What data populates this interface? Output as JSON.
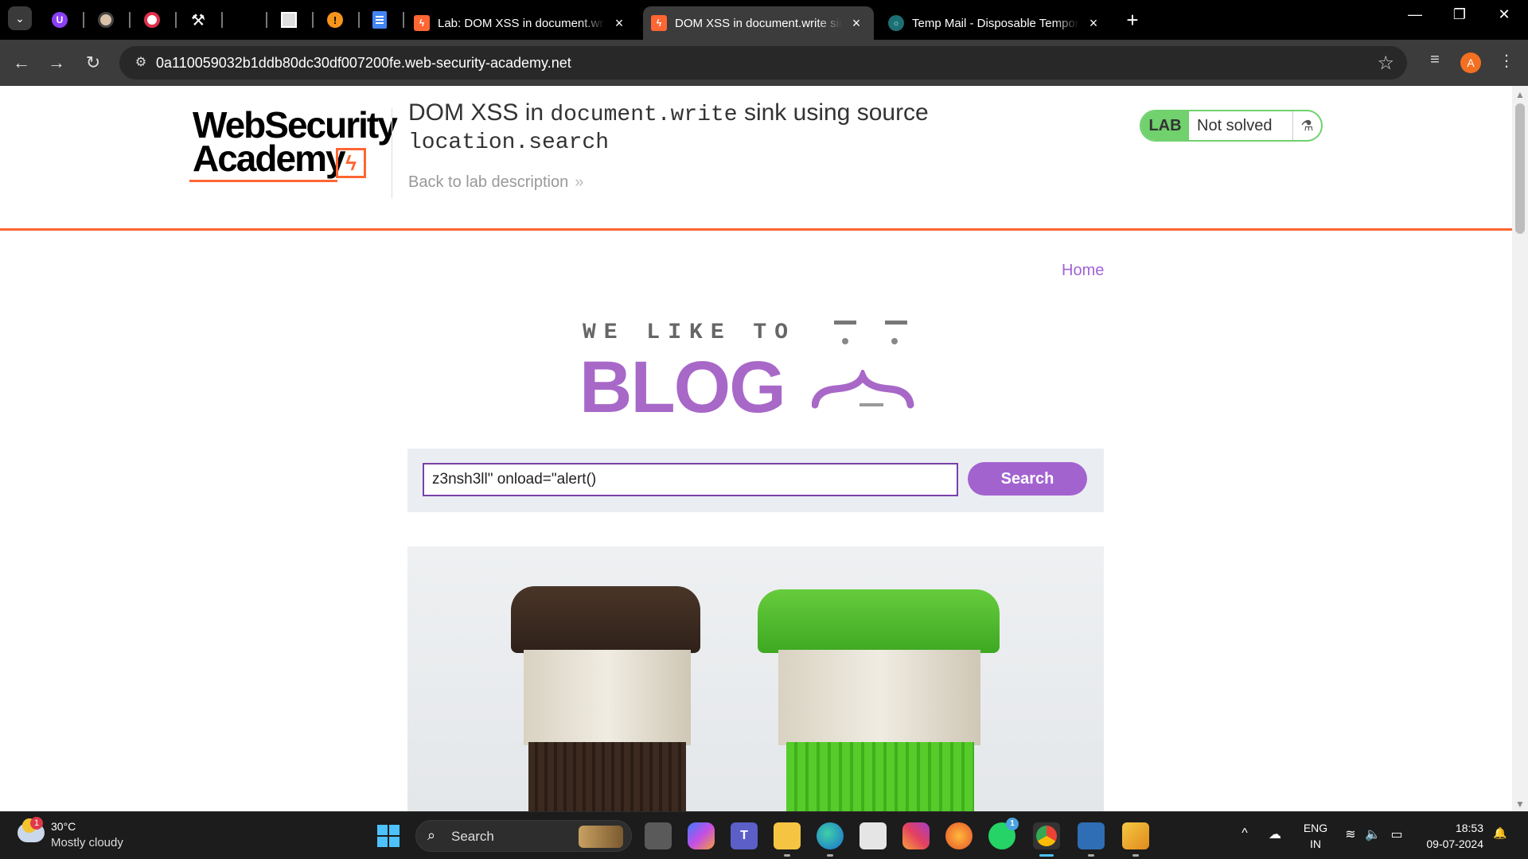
{
  "browser": {
    "tabs": [
      {
        "title": "Lab: DOM XSS in document.write",
        "favicon": "portswigger-icon",
        "active": false
      },
      {
        "title": "DOM XSS in document.write sink",
        "favicon": "portswigger-icon",
        "active": true
      },
      {
        "title": "Temp Mail - Disposable Temporary",
        "favicon": "tempmail-icon",
        "active": false
      }
    ],
    "pinned_icons": [
      "purple-shield-icon",
      "ninja-icon",
      "red-circle-icon",
      "tool-icon",
      "box-icon",
      "orange-info-icon",
      "google-docs-icon"
    ],
    "pinned_glyphs": {
      "purple": "U",
      "orange": "!"
    },
    "url": "0a110059032b1ddb80dc30df007200fe.web-security-academy.net",
    "profile_initial": "A",
    "icons": {
      "tab_close": "×",
      "new_tab": "+",
      "back": "←",
      "forward": "→",
      "reload": "↻",
      "star": "☆",
      "minimize": "—",
      "restore": "❐",
      "close": "✕",
      "menu": "⋮",
      "media": "≡",
      "site_info": "⚙",
      "tab_search": "⌄"
    }
  },
  "lab_header": {
    "logo_line1": "WebSecurity",
    "logo_line2": "Academy",
    "logo_bolt": "ϟ",
    "title_prefix": "DOM XSS in ",
    "title_code1": "document.write",
    "title_middle": " sink using source",
    "title_code2": "location.search",
    "back_link": "Back to lab description",
    "back_chevron": "»",
    "status_badge": "LAB",
    "status_text": "Not solved",
    "flask_icon": "⚗"
  },
  "blog": {
    "nav_home": "Home",
    "logo_top": "WE LIKE TO",
    "logo_big": "BLOG",
    "search_value": "z3nsh3ll\" onload=\"alert()",
    "search_button": "Search"
  },
  "scrollbar": {
    "up": "▲",
    "down": "▼"
  },
  "taskbar": {
    "weather_temp": "30°C",
    "weather_desc": "Mostly cloudy",
    "weather_badge": "1",
    "search_label": "Search",
    "search_icon": "⌕",
    "apps": [
      "task-view-icon",
      "copilot-icon",
      "teams-icon",
      "file-explorer-icon",
      "edge-icon",
      "ms-store-icon",
      "instagram-icon",
      "firefox-icon",
      "whatsapp-icon",
      "chrome-icon",
      "virtualbox-icon",
      "burp-icon"
    ],
    "whatsapp_badge": "1",
    "lang_line1": "ENG",
    "lang_line2": "IN",
    "time": "18:53",
    "date": "09-07-2024",
    "tray_up": "^",
    "tray_cloud": "☁",
    "tray_wifi": "≋",
    "tray_volume": "🔈",
    "tray_battery": "▭",
    "tray_bell": "🔔"
  },
  "colors": {
    "accent_orange": "#ff6633",
    "blog_purple": "#a868c8",
    "lab_green": "#70d16d"
  }
}
